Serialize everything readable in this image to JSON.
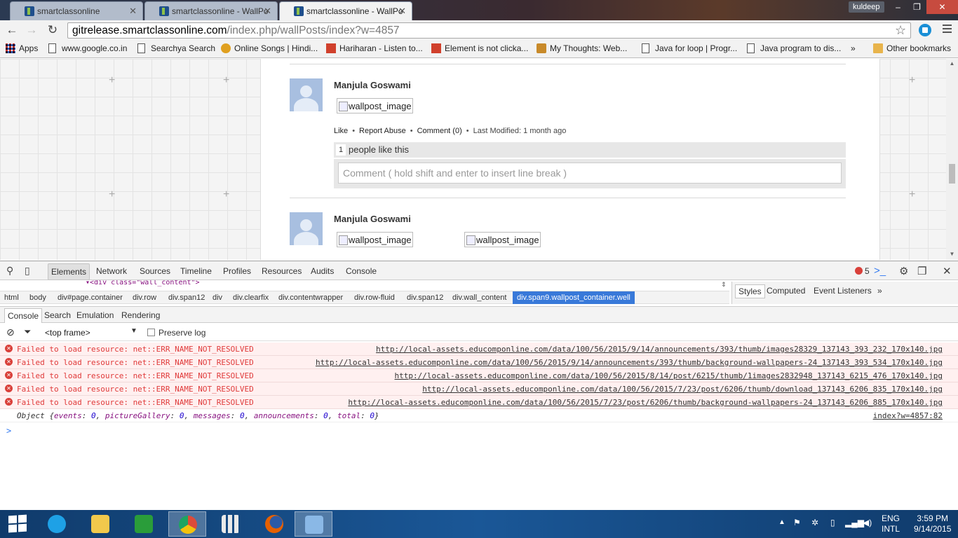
{
  "browser": {
    "tabs": [
      {
        "title": "smartclassonline",
        "state": "inactive"
      },
      {
        "title": "smartclassonline - WallPo",
        "state": "inactive"
      },
      {
        "title": "smartclassonline - WallPo",
        "state": "active"
      }
    ],
    "profile_name": "kuldeep",
    "url_host": "gitrelease.smartclassonline.com",
    "url_path": "/index.php/wallPosts/index?w=4857",
    "bookmarks": [
      {
        "label": "Apps",
        "icon": "apps-grid-icon"
      },
      {
        "label": "www.google.co.in",
        "icon": "page-icon"
      },
      {
        "label": "Searchya Search",
        "icon": "page-icon"
      },
      {
        "label": "Online Songs | Hindi...",
        "icon": "music-icon"
      },
      {
        "label": "Hariharan - Listen to...",
        "icon": "music-icon"
      },
      {
        "label": "Element is not clicka...",
        "icon": "stackoverflow-icon"
      },
      {
        "label": "My Thoughts: Web...",
        "icon": "blog-icon"
      },
      {
        "label": "Java for loop | Progr...",
        "icon": "page-icon"
      },
      {
        "label": "Java program to dis...",
        "icon": "page-icon"
      }
    ],
    "bookmarks_overflow": "»",
    "other_bookmarks": "Other bookmarks"
  },
  "page": {
    "posts": [
      {
        "author": "Manjula Goswami",
        "images": [
          "wallpost_image"
        ],
        "actions": {
          "like": "Like",
          "report": "Report Abuse",
          "comment": "Comment (0)",
          "modified_label": "Last Modified:",
          "modified_value": "1 month ago"
        },
        "likes_count": "1",
        "likes_label": "people like this",
        "comment_placeholder": "Comment ( hold shift and enter to insert line break )"
      },
      {
        "author": "Manjula Goswami",
        "images": [
          "wallpost_image",
          "wallpost_image"
        ]
      }
    ]
  },
  "devtools": {
    "tabs": [
      "Elements",
      "Network",
      "Sources",
      "Timeline",
      "Profiles",
      "Resources",
      "Audits",
      "Console"
    ],
    "active_tab": "Elements",
    "error_count": "5",
    "elements_snippet": "▾<div class=\"wall_content\">",
    "breadcrumb": [
      "html",
      "body",
      "div#page.container",
      "div.row",
      "div.span12",
      "div",
      "div.clearfix",
      "div.contentwrapper",
      "div.row-fluid",
      "div.span12",
      "div.wall_content",
      "div.span9.wallpost_container.well"
    ],
    "sidebar_tabs": [
      "Styles",
      "Computed",
      "Event Listeners"
    ],
    "sidebar_overflow": "»",
    "drawer_tabs": [
      "Console",
      "Search",
      "Emulation",
      "Rendering"
    ],
    "frame": "<top frame>",
    "preserve_log": "Preserve log",
    "messages": [
      {
        "text": "Failed to load resource: net::ERR_NAME_NOT_RESOLVED",
        "source": "http://local-assets.educomponline.com/data/100/56/2015/9/14/announcements/393/thumb/images28329_137143_393_232_170x140.jpg"
      },
      {
        "text": "Failed to load resource: net::ERR_NAME_NOT_RESOLVED",
        "source": "http://local-assets.educomponline.com/data/100/56/2015/9/14/announcements/393/thumb/background-wallpapers-24_137143_393_534_170x140.jpg"
      },
      {
        "text": "Failed to load resource: net::ERR_NAME_NOT_RESOLVED",
        "source": "http://local-assets.educomponline.com/data/100/56/2015/8/14/post/6215/thumb/1images2832948_137143_6215_476_170x140.jpg"
      },
      {
        "text": "Failed to load resource: net::ERR_NAME_NOT_RESOLVED",
        "source": "http://local-assets.educomponline.com/data/100/56/2015/7/23/post/6206/thumb/download_137143_6206_835_170x140.jpg"
      },
      {
        "text": "Failed to load resource: net::ERR_NAME_NOT_RESOLVED",
        "source": "http://local-assets.educomponline.com/data/100/56/2015/7/23/post/6206/thumb/background-wallpapers-24_137143_6206_885_170x140.jpg"
      }
    ],
    "object_log": {
      "prefix": "Object {",
      "pairs": [
        {
          "key": "events",
          "value": "0"
        },
        {
          "key": "pictureGallery",
          "value": "0"
        },
        {
          "key": "messages",
          "value": "0"
        },
        {
          "key": "announcements",
          "value": "0"
        },
        {
          "key": "total",
          "value": "0"
        }
      ],
      "suffix": "}",
      "source": "index?w=4857:82"
    },
    "prompt": ">"
  },
  "taskbar": {
    "lang_top": "ENG",
    "lang_bottom": "INTL",
    "time": "3:59 PM",
    "date": "9/14/2015",
    "colors": {
      "ie": "#1ea1e6",
      "explorer": "#f2c94c",
      "store": "#2a9d3a",
      "chrome": "#dd4b39",
      "apps": "#e9e9e9",
      "firefox": "#e66000",
      "paint": "#8ab8e6"
    }
  }
}
